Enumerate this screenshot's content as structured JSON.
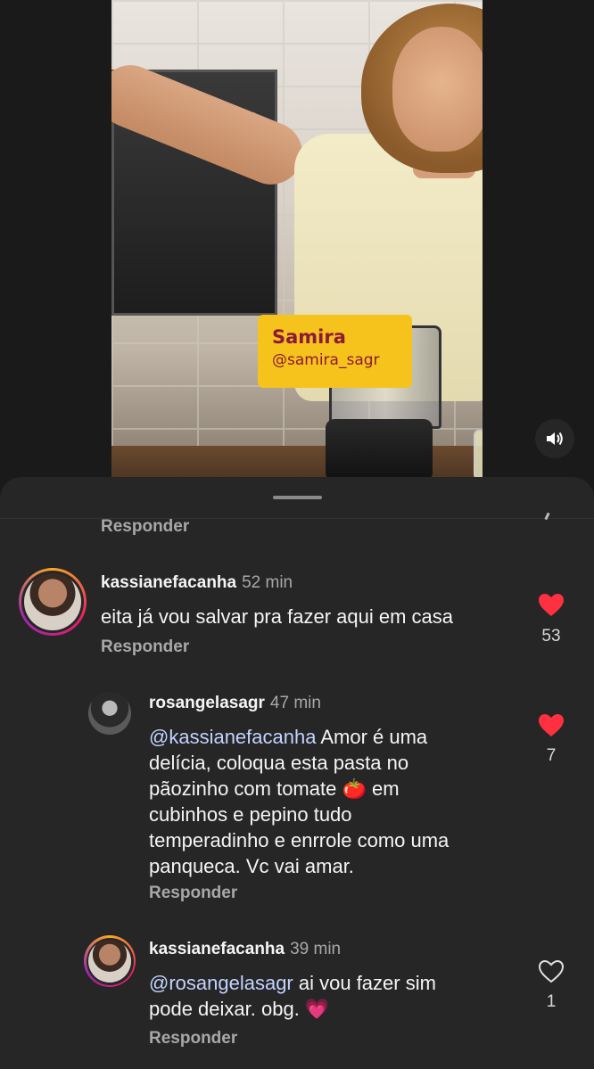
{
  "video": {
    "overlay_name": "Samira",
    "overlay_handle": "@samira_sagr",
    "sound_icon": "volume-on-icon"
  },
  "sheet": {
    "top_reply_label": "Responder"
  },
  "comments": [
    {
      "username": "kassianefacanha",
      "time": "52 min",
      "text": "eita já vou salvar pra fazer aqui em casa",
      "reply_label": "Responder",
      "likes": "53",
      "liked": true
    },
    {
      "username": "rosangelasagr",
      "time": "47 min",
      "mention": "@kassianefacanha",
      "text_line1": " Amor é uma",
      "text_line2": "delícia, coloqua esta pasta no",
      "text_line3a": "pãozinho com tomate ",
      "text_line3_emoji": "🍅",
      "text_line3b": " em",
      "text_line4": "cubinhos e pepino tudo",
      "text_line5": "temperadinho e enrrole como uma",
      "text_line6": "panqueca. Vc vai amar.",
      "reply_label": "Responder",
      "likes": "7",
      "liked": true
    },
    {
      "username": "kassianefacanha",
      "time": "39 min",
      "mention": "@rosangelasagr",
      "text_line1": " ai vou fazer sim",
      "text_line2": "pode deixar. obg. ",
      "emoji": "💗",
      "reply_label": "Responder",
      "likes": "1",
      "liked": false
    }
  ],
  "colors": {
    "heart_liked": "#ff3040",
    "sheet_bg": "#262626",
    "name_card": "#f6c21c",
    "name_card_text": "#8b1a3b"
  }
}
